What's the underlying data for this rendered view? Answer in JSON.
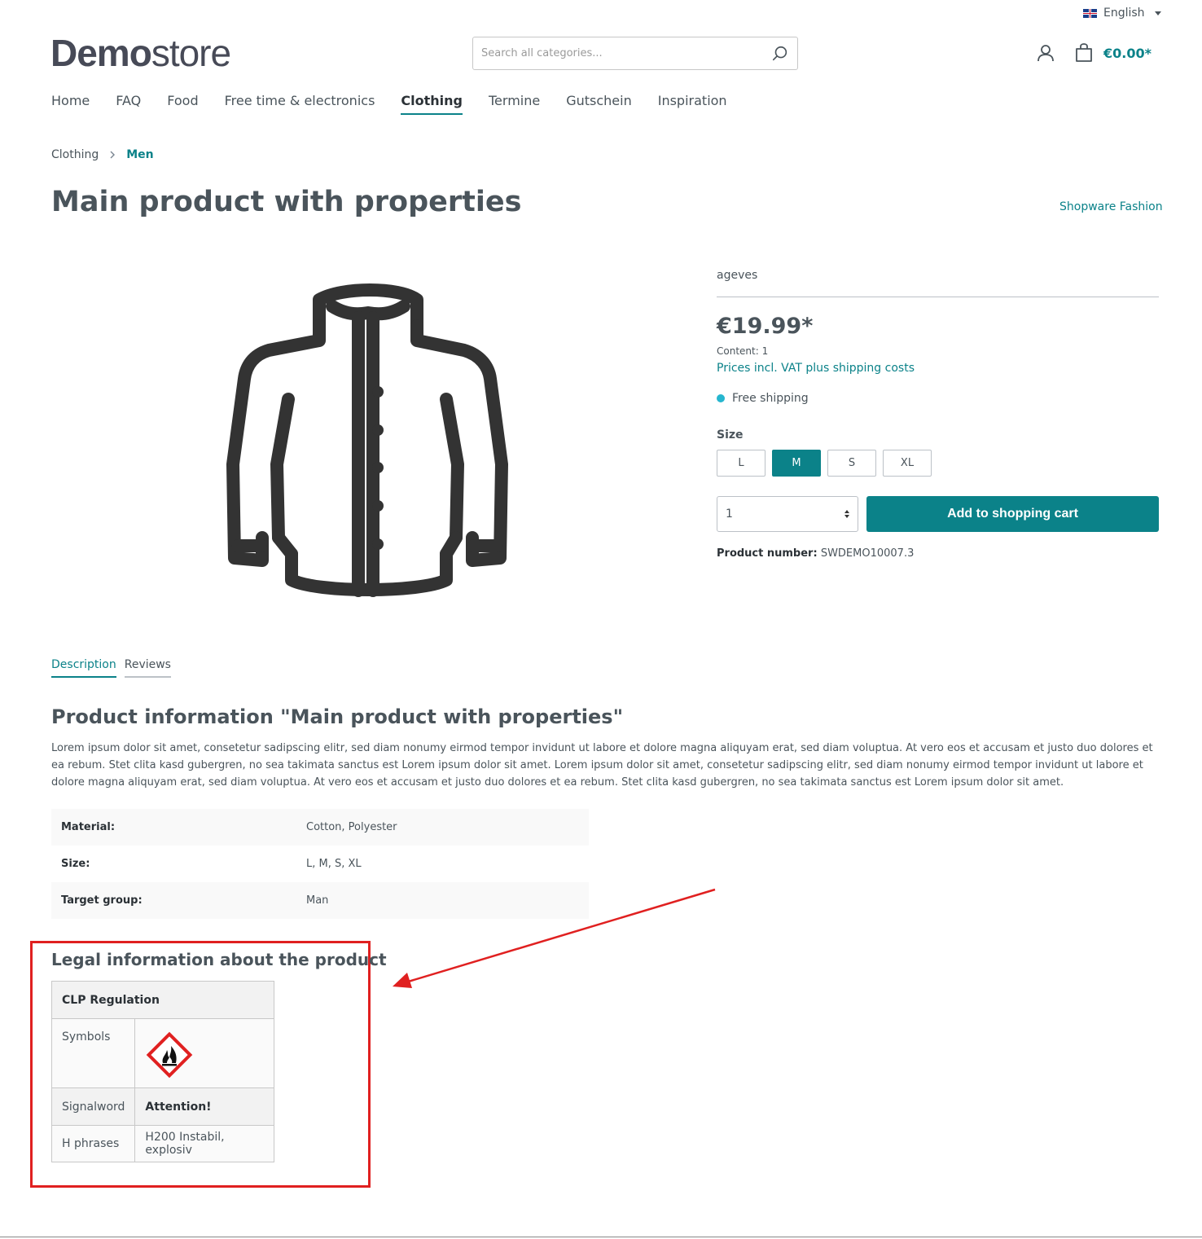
{
  "header": {
    "language": "English",
    "logo_bold": "Demo",
    "logo_light": "store",
    "search_placeholder": "Search all categories...",
    "cart_total": "€0.00*"
  },
  "nav": [
    "Home",
    "FAQ",
    "Food",
    "Free time & electronics",
    "Clothing",
    "Termine",
    "Gutschein",
    "Inspiration"
  ],
  "nav_active": "Clothing",
  "breadcrumb": {
    "parent": "Clothing",
    "current": "Men"
  },
  "product": {
    "title": "Main product with properties",
    "brand": "Shopware Fashion",
    "manufacturer": "ageves",
    "price": "€19.99*",
    "content": "Content: 1",
    "vat_note": "Prices incl. VAT plus shipping costs",
    "shipping": "Free shipping",
    "size_label": "Size",
    "sizes": [
      "L",
      "M",
      "S",
      "XL"
    ],
    "selected_size": "M",
    "quantity": "1",
    "add_to_cart": "Add to shopping cart",
    "number_label": "Product number:",
    "number": "SWDEMO10007.3"
  },
  "tabs": [
    "Description",
    "Reviews"
  ],
  "description": {
    "title": "Product information \"Main product with properties\"",
    "text": "Lorem ipsum dolor sit amet, consetetur sadipscing elitr, sed diam nonumy eirmod tempor invidunt ut labore et dolore magna aliquyam erat, sed diam voluptua. At vero eos et accusam et justo duo dolores et ea rebum. Stet clita kasd gubergren, no sea takimata sanctus est Lorem ipsum dolor sit amet. Lorem ipsum dolor sit amet, consetetur sadipscing elitr, sed diam nonumy eirmod tempor invidunt ut labore et dolore magna aliquyam erat, sed diam voluptua. At vero eos et accusam et justo duo dolores et ea rebum. Stet clita kasd gubergren, no sea takimata sanctus est Lorem ipsum dolor sit amet."
  },
  "properties": [
    {
      "key": "Material:",
      "value": "Cotton, Polyester"
    },
    {
      "key": "Size:",
      "value": "L, M, S, XL"
    },
    {
      "key": "Target group:",
      "value": "Man"
    }
  ],
  "legal": {
    "title": "Legal information about the product",
    "table_header": "CLP Regulation",
    "symbols_label": "Symbols",
    "symbol_icon": "flammable-hazard-icon",
    "signalword_label": "Signalword",
    "signalword": "Attention!",
    "hphrases_label": "H phrases",
    "hphrases": "H200 Instabil, explosiv"
  },
  "colors": {
    "accent": "#0b8289",
    "annotation": "#e02020",
    "text": "#4a545b"
  }
}
